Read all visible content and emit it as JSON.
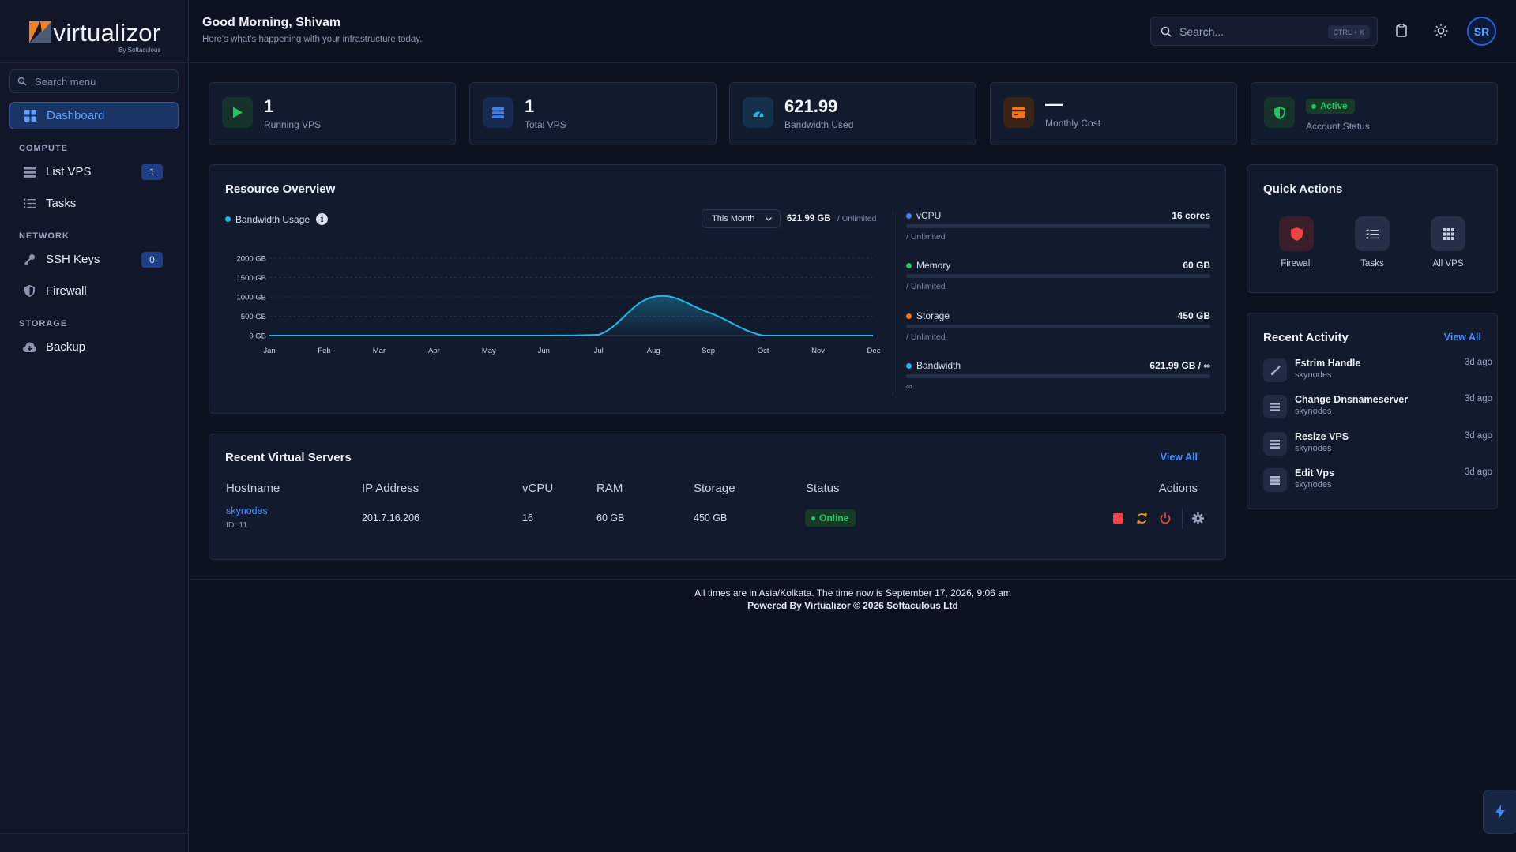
{
  "sidebar": {
    "logo_text": "virtualizor",
    "logo_sub": "By Softaculous",
    "search_placeholder": "Search menu",
    "dashboard": "Dashboard",
    "sections": {
      "compute": "COMPUTE",
      "network": "NETWORK",
      "storage": "STORAGE"
    },
    "items": {
      "list_vps": {
        "label": "List VPS",
        "badge": "1"
      },
      "tasks": {
        "label": "Tasks"
      },
      "ssh_keys": {
        "label": "SSH Keys",
        "badge": "0"
      },
      "firewall": {
        "label": "Firewall"
      },
      "backup": {
        "label": "Backup"
      }
    }
  },
  "header": {
    "greeting": "Good Morning, Shivam",
    "subtitle": "Here's what's happening with your infrastructure today.",
    "search_placeholder": "Search...",
    "shortcut": "CTRL + K",
    "avatar_initials": "SR"
  },
  "stats": [
    {
      "value": "1",
      "label": "Running VPS",
      "icon": "play-icon",
      "color": "#22c55e"
    },
    {
      "value": "1",
      "label": "Total VPS",
      "icon": "server-stack-icon",
      "color": "#3b82f6"
    },
    {
      "value": "621.99",
      "label": "Bandwidth Used",
      "icon": "gauge-icon",
      "color": "#22b8e6"
    },
    {
      "value": "—",
      "label": "Monthly Cost",
      "icon": "credit-card-icon",
      "color": "#f97316"
    },
    {
      "badge": "Active",
      "label": "Account Status",
      "icon": "shield-check-icon",
      "color": "#22c55e"
    }
  ],
  "resource_overview": {
    "title": "Resource Overview",
    "chart_legend": "Bandwidth Usage",
    "period": "This Month",
    "total": "621.99 GB",
    "total_limit": "/ Unlimited",
    "resources": [
      {
        "name": "vCPU",
        "value": "16 cores",
        "sub": "/ Unlimited",
        "color": "#3b82f6"
      },
      {
        "name": "Memory",
        "value": "60 GB",
        "sub": "/ Unlimited",
        "color": "#22c55e"
      },
      {
        "name": "Storage",
        "value": "450 GB",
        "sub": "/ Unlimited",
        "color": "#f97316"
      },
      {
        "name": "Bandwidth",
        "value": "621.99 GB / ∞",
        "sub": "∞",
        "color": "#22b8e6"
      }
    ]
  },
  "chart_data": {
    "type": "area",
    "series": [
      {
        "name": "Bandwidth Usage",
        "values": [
          0,
          0,
          0,
          0,
          0,
          0,
          20,
          1000,
          600,
          0,
          0,
          0
        ]
      }
    ],
    "categories": [
      "Jan",
      "Feb",
      "Mar",
      "Apr",
      "May",
      "Jun",
      "Jul",
      "Aug",
      "Sep",
      "Oct",
      "Nov",
      "Dec"
    ],
    "y_ticks": [
      "2000 GB",
      "1500 GB",
      "1000 GB",
      "500 GB",
      "0 GB"
    ],
    "ylim": [
      0,
      2000
    ],
    "color": "#22b8e6",
    "grid": true
  },
  "servers": {
    "title": "Recent Virtual Servers",
    "view_all": "View All",
    "columns": [
      "Hostname",
      "IP Address",
      "vCPU",
      "RAM",
      "Storage",
      "Status",
      "Actions"
    ],
    "rows": [
      {
        "hostname": "skynodes",
        "id": "ID: 11",
        "ip": "201.7.16.206",
        "vcpu": "16",
        "ram": "60 GB",
        "storage": "450 GB",
        "status": "Online"
      }
    ]
  },
  "quick_actions": {
    "title": "Quick Actions",
    "items": [
      {
        "label": "Firewall",
        "icon": "shield-icon"
      },
      {
        "label": "Tasks",
        "icon": "list-check-icon"
      },
      {
        "label": "All VPS",
        "icon": "grid-icon"
      }
    ]
  },
  "recent_activity": {
    "title": "Recent Activity",
    "view_all": "View All",
    "items": [
      {
        "title": "Fstrim Handle",
        "sub": "skynodes",
        "time": "3d ago",
        "icon": "brush-icon"
      },
      {
        "title": "Change Dnsnameserver",
        "sub": "skynodes",
        "time": "3d ago",
        "icon": "server-icon"
      },
      {
        "title": "Resize VPS",
        "sub": "skynodes",
        "time": "3d ago",
        "icon": "server-icon"
      },
      {
        "title": "Edit Vps",
        "sub": "skynodes",
        "time": "3d ago",
        "icon": "server-icon"
      }
    ]
  },
  "footer": {
    "line1": "All times are in Asia/Kolkata. The time now is September 17, 2026, 9:06 am",
    "line2": "Powered By Virtualizor © 2026 Softaculous Ltd"
  }
}
